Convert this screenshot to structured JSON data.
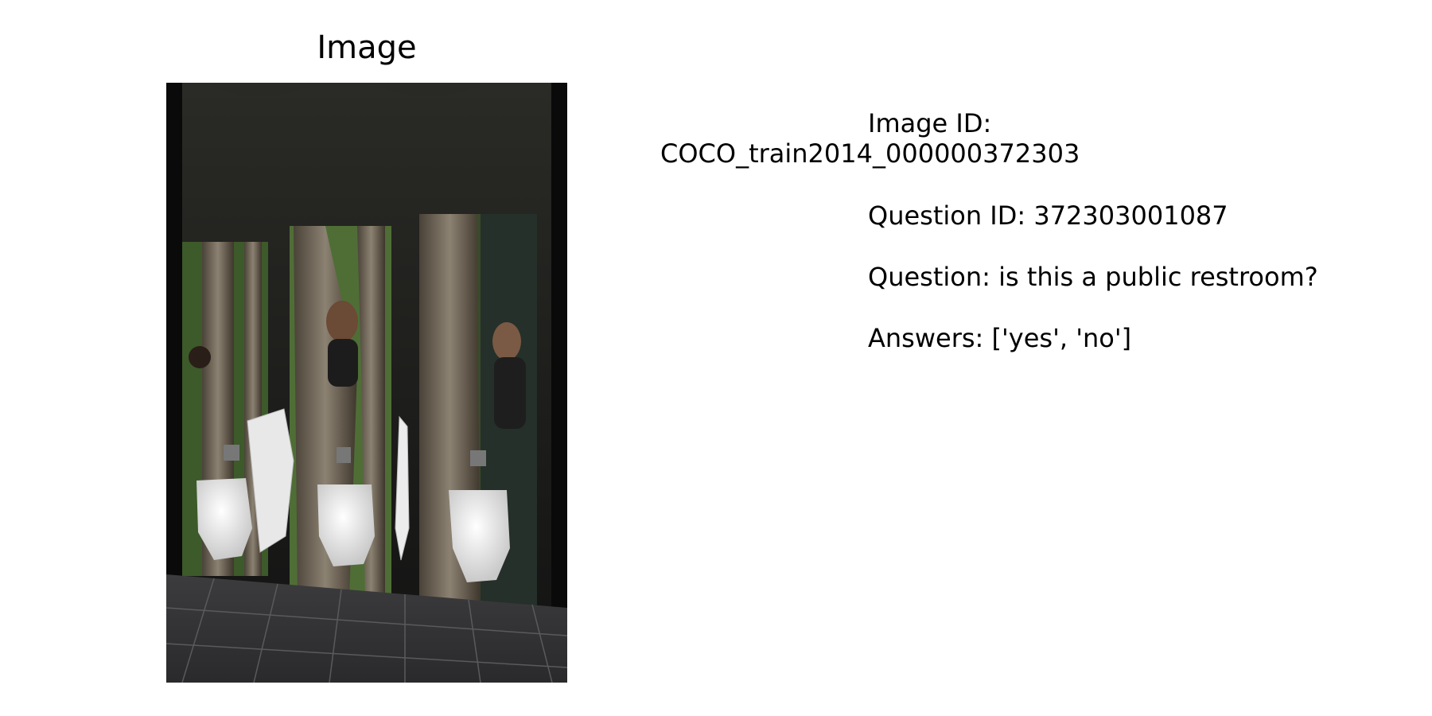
{
  "panel": {
    "title": "Image",
    "photo_description": "Restroom with three white urinals against walls printed with tree trunks and women peeking out"
  },
  "info": {
    "image_id_label": "Image ID:",
    "image_id_value": "COCO_train2014_000000372303",
    "question_id_text": "Question ID: 372303001087",
    "question_text": "Question: is this a public restroom?",
    "answers_text": "Answers: ['yes', 'no']"
  },
  "colors": {
    "background": "#ffffff",
    "text": "#000000"
  }
}
